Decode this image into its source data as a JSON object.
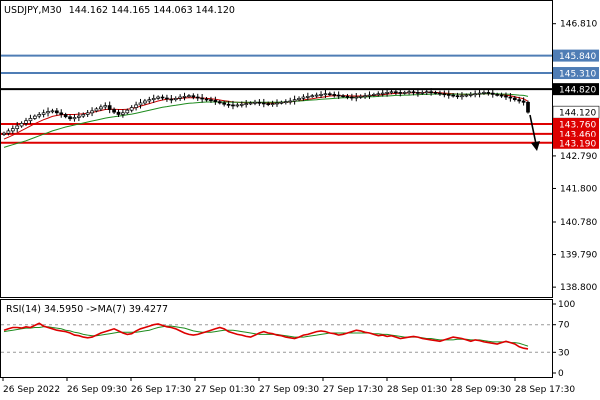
{
  "chart_data": [
    {
      "type": "candlestick",
      "title": "USDJPY,M30",
      "ohlc_label": "144.162 144.165 144.063 144.120",
      "ylim": [
        138.5,
        147.5
      ],
      "y_ticks": [
        "146.810",
        "142.790",
        "141.800",
        "140.780",
        "139.790",
        "138.800"
      ],
      "x_tick_labels": [
        "26 Sep 2022",
        "26 Sep 09:30",
        "26 Sep 17:30",
        "27 Sep 01:30",
        "27 Sep 09:30",
        "27 Sep 17:30",
        "28 Sep 01:30",
        "28 Sep 09:30",
        "28 Sep 17:30"
      ],
      "horizontal_levels": [
        {
          "value": 145.84,
          "label": "145.840",
          "color": "#4f7db5",
          "text_color": "#ffffff"
        },
        {
          "value": 145.31,
          "label": "145.310",
          "color": "#4f7db5",
          "text_color": "#ffffff"
        },
        {
          "value": 144.82,
          "label": "144.820",
          "color": "#000000",
          "text_color": "#ffffff"
        },
        {
          "value": 144.12,
          "label": "144.120",
          "color": "#ffffff",
          "text_color": "#000000"
        },
        {
          "value": 143.76,
          "label": "143.760",
          "color": "#dd0000",
          "text_color": "#ffffff"
        },
        {
          "value": 143.46,
          "label": "143.460",
          "color": "#dd0000",
          "text_color": "#ffffff"
        },
        {
          "value": 143.19,
          "label": "143.190",
          "color": "#dd0000",
          "text_color": "#ffffff"
        }
      ],
      "close": [
        143.48,
        143.55,
        143.62,
        143.7,
        143.78,
        143.86,
        143.93,
        144.0,
        144.05,
        144.1,
        144.14,
        144.16,
        144.1,
        144.05,
        143.98,
        143.92,
        143.96,
        144.0,
        144.05,
        144.1,
        144.16,
        144.22,
        144.28,
        144.32,
        144.2,
        144.12,
        144.05,
        144.1,
        144.18,
        144.26,
        144.34,
        144.4,
        144.46,
        144.5,
        144.54,
        144.58,
        144.55,
        144.52,
        144.5,
        144.54,
        144.58,
        144.6,
        144.62,
        144.58,
        144.55,
        144.52,
        144.5,
        144.48,
        144.44,
        144.4,
        144.36,
        144.34,
        144.32,
        144.34,
        144.36,
        144.38,
        144.4,
        144.42,
        144.4,
        144.38,
        144.36,
        144.38,
        144.4,
        144.42,
        144.44,
        144.46,
        144.5,
        144.54,
        144.58,
        144.6,
        144.62,
        144.64,
        144.66,
        144.68,
        144.66,
        144.64,
        144.62,
        144.6,
        144.58,
        144.56,
        144.58,
        144.6,
        144.62,
        144.64,
        144.66,
        144.68,
        144.7,
        144.72,
        144.74,
        144.72,
        144.7,
        144.72,
        144.74,
        144.72,
        144.7,
        144.72,
        144.74,
        144.72,
        144.7,
        144.68,
        144.66,
        144.64,
        144.62,
        144.6,
        144.62,
        144.64,
        144.66,
        144.68,
        144.7,
        144.72,
        144.7,
        144.66,
        144.64,
        144.62,
        144.58,
        144.55,
        144.5,
        144.46,
        144.42,
        144.12
      ],
      "series": [
        {
          "name": "MA",
          "color": "#cc0000",
          "values": [
            143.3,
            143.36,
            143.42,
            143.49,
            143.56,
            143.63,
            143.7,
            143.77,
            143.83,
            143.89,
            143.94,
            143.99,
            144.02,
            144.04,
            144.05,
            144.05,
            144.05,
            144.06,
            144.07,
            144.09,
            144.11,
            144.14,
            144.17,
            144.2,
            144.21,
            144.21,
            144.2,
            144.2,
            144.21,
            144.23,
            144.26,
            144.3,
            144.34,
            144.38,
            144.42,
            144.46,
            144.49,
            144.51,
            144.52,
            144.53,
            144.54,
            144.55,
            144.56,
            144.56,
            144.56,
            144.55,
            144.54,
            144.53,
            144.51,
            144.49,
            144.47,
            144.45,
            144.43,
            144.42,
            144.41,
            144.41,
            144.41,
            144.41,
            144.41,
            144.41,
            144.4,
            144.4,
            144.4,
            144.41,
            144.42,
            144.43,
            144.45,
            144.47,
            144.49,
            144.51,
            144.53,
            144.55,
            144.57,
            144.59,
            144.61,
            144.62,
            144.62,
            144.62,
            144.62,
            144.61,
            144.61,
            144.61,
            144.61,
            144.62,
            144.63,
            144.64,
            144.65,
            144.67,
            144.68,
            144.69,
            144.7,
            144.7,
            144.71,
            144.71,
            144.71,
            144.71,
            144.72,
            144.72,
            144.72,
            144.71,
            144.7,
            144.69,
            144.68,
            144.67,
            144.66,
            144.66,
            144.66,
            144.66,
            144.67,
            144.68,
            144.68,
            144.68,
            144.67,
            144.66,
            144.64,
            144.62,
            144.59,
            144.56,
            144.53,
            144.45
          ]
        },
        {
          "name": "MA",
          "color": "#1e8c1e",
          "values": [
            143.05,
            143.09,
            143.13,
            143.17,
            143.21,
            143.25,
            143.3,
            143.35,
            143.4,
            143.45,
            143.5,
            143.55,
            143.59,
            143.63,
            143.67,
            143.7,
            143.73,
            143.76,
            143.79,
            143.82,
            143.85,
            143.88,
            143.91,
            143.94,
            143.96,
            143.98,
            144.0,
            144.02,
            144.04,
            144.06,
            144.09,
            144.12,
            144.15,
            144.18,
            144.21,
            144.24,
            144.27,
            144.29,
            144.31,
            144.33,
            144.35,
            144.37,
            144.39,
            144.4,
            144.41,
            144.42,
            144.43,
            144.43,
            144.43,
            144.43,
            144.43,
            144.43,
            144.42,
            144.42,
            144.42,
            144.42,
            144.42,
            144.42,
            144.42,
            144.42,
            144.42,
            144.42,
            144.42,
            144.43,
            144.43,
            144.44,
            144.45,
            144.46,
            144.47,
            144.48,
            144.49,
            144.5,
            144.51,
            144.52,
            144.53,
            144.54,
            144.55,
            144.56,
            144.56,
            144.57,
            144.57,
            144.58,
            144.58,
            144.59,
            144.59,
            144.6,
            144.61,
            144.61,
            144.62,
            144.63,
            144.63,
            144.64,
            144.64,
            144.65,
            144.65,
            144.66,
            144.66,
            144.67,
            144.67,
            144.67,
            144.67,
            144.67,
            144.67,
            144.67,
            144.67,
            144.67,
            144.67,
            144.67,
            144.67,
            144.68,
            144.68,
            144.68,
            144.68,
            144.67,
            144.67,
            144.66,
            144.65,
            144.64,
            144.63,
            144.6
          ]
        }
      ],
      "annotation": "down-arrow"
    },
    {
      "type": "line",
      "title": "RSI(14) 34.5950  ->MA(7) 39.4277",
      "ylim": [
        0,
        100
      ],
      "y_ticks": [
        "100",
        "70",
        "30",
        "0"
      ],
      "levels": [
        70,
        30
      ],
      "series": [
        {
          "name": "RSI(14)",
          "color": "#dd0000",
          "values": [
            62,
            64,
            66,
            66,
            65,
            67,
            66,
            69,
            72,
            68,
            66,
            64,
            62,
            61,
            60,
            58,
            55,
            54,
            52,
            51,
            52,
            55,
            58,
            60,
            62,
            64,
            61,
            58,
            56,
            57,
            61,
            64,
            66,
            68,
            70,
            71,
            69,
            67,
            66,
            64,
            61,
            58,
            56,
            55,
            56,
            58,
            60,
            62,
            64,
            66,
            64,
            60,
            58,
            56,
            55,
            53,
            52,
            55,
            58,
            60,
            58,
            57,
            55,
            54,
            52,
            51,
            50,
            52,
            55,
            56,
            58,
            60,
            61,
            60,
            58,
            57,
            55,
            56,
            58,
            60,
            62,
            61,
            59,
            58,
            56,
            54,
            55,
            53,
            54,
            52,
            50,
            51,
            52,
            53,
            52,
            50,
            49,
            48,
            47,
            46,
            48,
            50,
            52,
            51,
            50,
            48,
            46,
            48,
            47,
            45,
            44,
            43,
            42,
            44,
            46,
            44,
            42,
            38,
            36,
            35
          ]
        },
        {
          "name": "MA(7)",
          "color": "#1e8c1e",
          "values": [
            60,
            61,
            62,
            63,
            64,
            65,
            65,
            66,
            66,
            67,
            67,
            66,
            65,
            64,
            62,
            61,
            59,
            58,
            56,
            55,
            54,
            54,
            55,
            56,
            57,
            58,
            59,
            59,
            59,
            59,
            59,
            60,
            61,
            62,
            64,
            66,
            67,
            68,
            68,
            67,
            66,
            65,
            63,
            61,
            60,
            59,
            59,
            59,
            60,
            61,
            62,
            62,
            62,
            61,
            60,
            59,
            58,
            57,
            56,
            56,
            56,
            56,
            56,
            55,
            54,
            53,
            52,
            52,
            52,
            53,
            54,
            55,
            56,
            57,
            58,
            58,
            58,
            58,
            58,
            58,
            58,
            58,
            58,
            58,
            57,
            57,
            56,
            56,
            55,
            54,
            53,
            52,
            52,
            52,
            52,
            51,
            50,
            50,
            49,
            48,
            48,
            48,
            48,
            49,
            49,
            49,
            48,
            48,
            48,
            47,
            46,
            45,
            45,
            45,
            45,
            44,
            44,
            43,
            41,
            39
          ]
        }
      ]
    }
  ]
}
